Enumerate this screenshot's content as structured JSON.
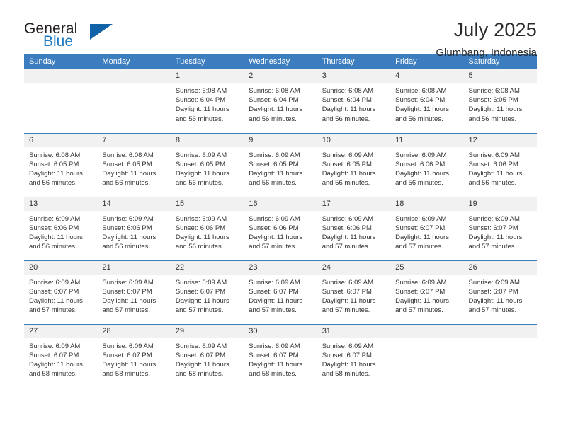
{
  "brand": {
    "name_part1": "General",
    "name_part2": "Blue",
    "logo_icon": "triangle-icon"
  },
  "header": {
    "title": "July 2025",
    "subtitle": "Glumbang, Indonesia"
  },
  "colors": {
    "header_blue": "#3b7dbf",
    "brand_blue": "#1f7ac4",
    "logo_triangle": "#1262a8",
    "daynum_band": "#f1f1f1",
    "text": "#333333"
  },
  "calendar": {
    "weekday_headers": [
      "Sunday",
      "Monday",
      "Tuesday",
      "Wednesday",
      "Thursday",
      "Friday",
      "Saturday"
    ],
    "weeks": [
      [
        {
          "day": "",
          "sunrise": "",
          "sunset": "",
          "daylight": ""
        },
        {
          "day": "",
          "sunrise": "",
          "sunset": "",
          "daylight": ""
        },
        {
          "day": "1",
          "sunrise": "Sunrise: 6:08 AM",
          "sunset": "Sunset: 6:04 PM",
          "daylight": "Daylight: 11 hours and 56 minutes."
        },
        {
          "day": "2",
          "sunrise": "Sunrise: 6:08 AM",
          "sunset": "Sunset: 6:04 PM",
          "daylight": "Daylight: 11 hours and 56 minutes."
        },
        {
          "day": "3",
          "sunrise": "Sunrise: 6:08 AM",
          "sunset": "Sunset: 6:04 PM",
          "daylight": "Daylight: 11 hours and 56 minutes."
        },
        {
          "day": "4",
          "sunrise": "Sunrise: 6:08 AM",
          "sunset": "Sunset: 6:04 PM",
          "daylight": "Daylight: 11 hours and 56 minutes."
        },
        {
          "day": "5",
          "sunrise": "Sunrise: 6:08 AM",
          "sunset": "Sunset: 6:05 PM",
          "daylight": "Daylight: 11 hours and 56 minutes."
        }
      ],
      [
        {
          "day": "6",
          "sunrise": "Sunrise: 6:08 AM",
          "sunset": "Sunset: 6:05 PM",
          "daylight": "Daylight: 11 hours and 56 minutes."
        },
        {
          "day": "7",
          "sunrise": "Sunrise: 6:08 AM",
          "sunset": "Sunset: 6:05 PM",
          "daylight": "Daylight: 11 hours and 56 minutes."
        },
        {
          "day": "8",
          "sunrise": "Sunrise: 6:09 AM",
          "sunset": "Sunset: 6:05 PM",
          "daylight": "Daylight: 11 hours and 56 minutes."
        },
        {
          "day": "9",
          "sunrise": "Sunrise: 6:09 AM",
          "sunset": "Sunset: 6:05 PM",
          "daylight": "Daylight: 11 hours and 56 minutes."
        },
        {
          "day": "10",
          "sunrise": "Sunrise: 6:09 AM",
          "sunset": "Sunset: 6:05 PM",
          "daylight": "Daylight: 11 hours and 56 minutes."
        },
        {
          "day": "11",
          "sunrise": "Sunrise: 6:09 AM",
          "sunset": "Sunset: 6:06 PM",
          "daylight": "Daylight: 11 hours and 56 minutes."
        },
        {
          "day": "12",
          "sunrise": "Sunrise: 6:09 AM",
          "sunset": "Sunset: 6:06 PM",
          "daylight": "Daylight: 11 hours and 56 minutes."
        }
      ],
      [
        {
          "day": "13",
          "sunrise": "Sunrise: 6:09 AM",
          "sunset": "Sunset: 6:06 PM",
          "daylight": "Daylight: 11 hours and 56 minutes."
        },
        {
          "day": "14",
          "sunrise": "Sunrise: 6:09 AM",
          "sunset": "Sunset: 6:06 PM",
          "daylight": "Daylight: 11 hours and 56 minutes."
        },
        {
          "day": "15",
          "sunrise": "Sunrise: 6:09 AM",
          "sunset": "Sunset: 6:06 PM",
          "daylight": "Daylight: 11 hours and 56 minutes."
        },
        {
          "day": "16",
          "sunrise": "Sunrise: 6:09 AM",
          "sunset": "Sunset: 6:06 PM",
          "daylight": "Daylight: 11 hours and 57 minutes."
        },
        {
          "day": "17",
          "sunrise": "Sunrise: 6:09 AM",
          "sunset": "Sunset: 6:06 PM",
          "daylight": "Daylight: 11 hours and 57 minutes."
        },
        {
          "day": "18",
          "sunrise": "Sunrise: 6:09 AM",
          "sunset": "Sunset: 6:07 PM",
          "daylight": "Daylight: 11 hours and 57 minutes."
        },
        {
          "day": "19",
          "sunrise": "Sunrise: 6:09 AM",
          "sunset": "Sunset: 6:07 PM",
          "daylight": "Daylight: 11 hours and 57 minutes."
        }
      ],
      [
        {
          "day": "20",
          "sunrise": "Sunrise: 6:09 AM",
          "sunset": "Sunset: 6:07 PM",
          "daylight": "Daylight: 11 hours and 57 minutes."
        },
        {
          "day": "21",
          "sunrise": "Sunrise: 6:09 AM",
          "sunset": "Sunset: 6:07 PM",
          "daylight": "Daylight: 11 hours and 57 minutes."
        },
        {
          "day": "22",
          "sunrise": "Sunrise: 6:09 AM",
          "sunset": "Sunset: 6:07 PM",
          "daylight": "Daylight: 11 hours and 57 minutes."
        },
        {
          "day": "23",
          "sunrise": "Sunrise: 6:09 AM",
          "sunset": "Sunset: 6:07 PM",
          "daylight": "Daylight: 11 hours and 57 minutes."
        },
        {
          "day": "24",
          "sunrise": "Sunrise: 6:09 AM",
          "sunset": "Sunset: 6:07 PM",
          "daylight": "Daylight: 11 hours and 57 minutes."
        },
        {
          "day": "25",
          "sunrise": "Sunrise: 6:09 AM",
          "sunset": "Sunset: 6:07 PM",
          "daylight": "Daylight: 11 hours and 57 minutes."
        },
        {
          "day": "26",
          "sunrise": "Sunrise: 6:09 AM",
          "sunset": "Sunset: 6:07 PM",
          "daylight": "Daylight: 11 hours and 57 minutes."
        }
      ],
      [
        {
          "day": "27",
          "sunrise": "Sunrise: 6:09 AM",
          "sunset": "Sunset: 6:07 PM",
          "daylight": "Daylight: 11 hours and 58 minutes."
        },
        {
          "day": "28",
          "sunrise": "Sunrise: 6:09 AM",
          "sunset": "Sunset: 6:07 PM",
          "daylight": "Daylight: 11 hours and 58 minutes."
        },
        {
          "day": "29",
          "sunrise": "Sunrise: 6:09 AM",
          "sunset": "Sunset: 6:07 PM",
          "daylight": "Daylight: 11 hours and 58 minutes."
        },
        {
          "day": "30",
          "sunrise": "Sunrise: 6:09 AM",
          "sunset": "Sunset: 6:07 PM",
          "daylight": "Daylight: 11 hours and 58 minutes."
        },
        {
          "day": "31",
          "sunrise": "Sunrise: 6:09 AM",
          "sunset": "Sunset: 6:07 PM",
          "daylight": "Daylight: 11 hours and 58 minutes."
        },
        {
          "day": "",
          "sunrise": "",
          "sunset": "",
          "daylight": ""
        },
        {
          "day": "",
          "sunrise": "",
          "sunset": "",
          "daylight": ""
        }
      ]
    ]
  }
}
